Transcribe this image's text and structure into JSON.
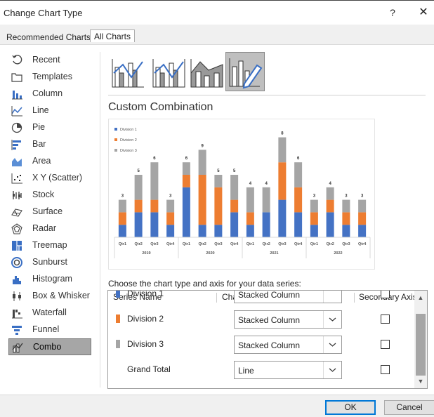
{
  "window": {
    "title": "Change Chart Type",
    "help_glyph": "?",
    "close_glyph": "✕"
  },
  "tabs": [
    {
      "label": "Recommended Charts"
    },
    {
      "label": "All Charts"
    }
  ],
  "sidebar": {
    "items": [
      {
        "label": "Recent",
        "icon": "recent-icon"
      },
      {
        "label": "Templates",
        "icon": "templates-icon"
      },
      {
        "label": "Column",
        "icon": "column-chart-icon"
      },
      {
        "label": "Line",
        "icon": "line-chart-icon"
      },
      {
        "label": "Pie",
        "icon": "pie-chart-icon"
      },
      {
        "label": "Bar",
        "icon": "bar-chart-icon"
      },
      {
        "label": "Area",
        "icon": "area-chart-icon"
      },
      {
        "label": "X Y (Scatter)",
        "icon": "scatter-chart-icon"
      },
      {
        "label": "Stock",
        "icon": "stock-chart-icon"
      },
      {
        "label": "Surface",
        "icon": "surface-chart-icon"
      },
      {
        "label": "Radar",
        "icon": "radar-chart-icon"
      },
      {
        "label": "Treemap",
        "icon": "treemap-icon"
      },
      {
        "label": "Sunburst",
        "icon": "sunburst-icon"
      },
      {
        "label": "Histogram",
        "icon": "histogram-icon"
      },
      {
        "label": "Box & Whisker",
        "icon": "box-whisker-icon"
      },
      {
        "label": "Waterfall",
        "icon": "waterfall-icon"
      },
      {
        "label": "Funnel",
        "icon": "funnel-icon"
      },
      {
        "label": "Combo",
        "icon": "combo-chart-icon",
        "selected": true
      }
    ]
  },
  "main": {
    "heading": "Custom Combination",
    "prompt": "Choose the chart type and axis for your data series:",
    "table": {
      "headers": {
        "series": "Series Name",
        "type": "Chart Type",
        "axis": "Secondary Axis"
      },
      "rows": [
        {
          "name": "Division 1",
          "type": "Stacked Column",
          "color": "#4472c4",
          "secondary": false
        },
        {
          "name": "Division 2",
          "type": "Stacked Column",
          "color": "#ed7d31",
          "secondary": false
        },
        {
          "name": "Division 3",
          "type": "Stacked Column",
          "color": "#a5a5a5",
          "secondary": false
        },
        {
          "name": "Grand Total",
          "type": "Line",
          "color": "",
          "secondary": false
        }
      ]
    }
  },
  "buttons": {
    "ok": "OK",
    "cancel": "Cancel"
  },
  "colors": {
    "div1": "#4472c4",
    "div2": "#ed7d31",
    "div3": "#a5a5a5",
    "accent": "#0078d7"
  },
  "chart_data": {
    "type": "bar",
    "stacked": true,
    "legend": "top-left",
    "categories": [
      "Qtr1",
      "Qtr2",
      "Qtr3",
      "Qtr4",
      "Qtr1",
      "Qtr2",
      "Qtr3",
      "Qtr4",
      "Qtr1",
      "Qtr2",
      "Qtr3",
      "Qtr4",
      "Qtr1",
      "Qtr2",
      "Qtr3",
      "Qtr4"
    ],
    "groups": [
      {
        "label": "2019",
        "count": 4
      },
      {
        "label": "2020",
        "count": 4
      },
      {
        "label": "2021",
        "count": 4
      },
      {
        "label": "2022",
        "count": 4
      }
    ],
    "series": [
      {
        "name": "Division 1",
        "values": [
          1,
          2,
          2,
          1,
          4,
          1,
          1,
          2,
          1,
          2,
          3,
          2,
          1,
          2,
          1,
          1
        ]
      },
      {
        "name": "Division 2",
        "values": [
          1,
          1,
          1,
          1,
          1,
          4,
          3,
          1,
          1,
          0,
          3,
          2,
          1,
          1,
          1,
          1
        ]
      },
      {
        "name": "Division 3",
        "values": [
          1,
          2,
          3,
          1,
          1,
          2,
          1,
          2,
          2,
          2,
          2,
          2,
          1,
          1,
          1,
          1
        ]
      }
    ],
    "totals": [
      3,
      5,
      6,
      3,
      6,
      9,
      5,
      5,
      4,
      4,
      8,
      6,
      3,
      4,
      3,
      3
    ],
    "ylim": [
      0,
      10
    ],
    "grid": false
  }
}
